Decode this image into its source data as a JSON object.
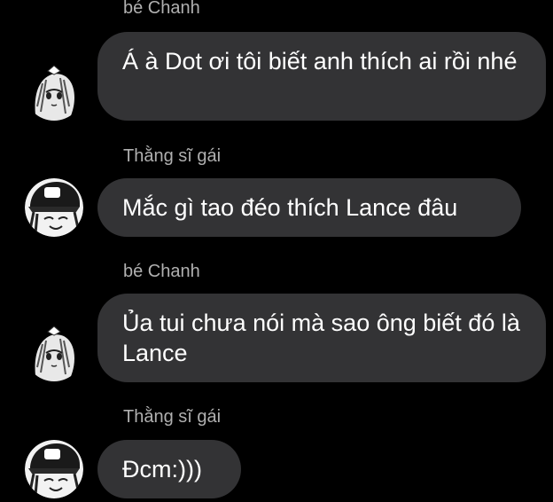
{
  "messages": [
    {
      "sender": "bé Chanh",
      "text": "Á à Dot ơi tôi biết anh thích ai rồi nhé",
      "avatar_icon": "anime-girl-avatar-icon"
    },
    {
      "sender": "Thằng sĩ gái",
      "text": "Mắc gì tao đéo thích Lance đâu",
      "avatar_icon": "anime-boy-cap-avatar-icon"
    },
    {
      "sender": "bé Chanh",
      "text": "Ủa tui chưa nói mà sao ông biết đó là Lance",
      "avatar_icon": "anime-girl-avatar-icon"
    },
    {
      "sender": "Thằng sĩ gái",
      "text": "Đcm:)))",
      "avatar_icon": "anime-boy-cap-avatar-icon"
    }
  ],
  "colors": {
    "background": "#000000",
    "bubble": "#333335",
    "sender_name": "#b0b0b0",
    "text": "#ffffff"
  }
}
